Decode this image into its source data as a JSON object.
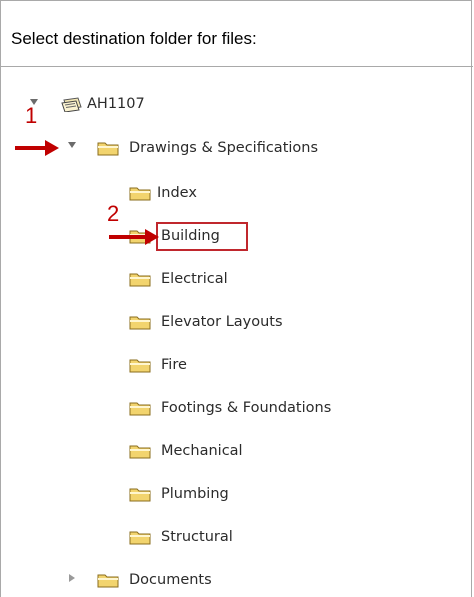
{
  "dialog": {
    "header": "Select destination folder for files:"
  },
  "tree": {
    "root": {
      "label": "AH1107",
      "expanded": true
    },
    "drawings": {
      "label": "Drawings & Specifications",
      "expanded": true
    },
    "children": [
      {
        "label": "Index"
      },
      {
        "label": "Building",
        "selected": true
      },
      {
        "label": "Electrical"
      },
      {
        "label": "Elevator Layouts"
      },
      {
        "label": "Fire"
      },
      {
        "label": "Footings & Foundations"
      },
      {
        "label": "Mechanical"
      },
      {
        "label": "Plumbing"
      },
      {
        "label": "Structural"
      }
    ],
    "documents": {
      "label": "Documents",
      "expanded": false
    }
  },
  "annotations": {
    "step1": "1",
    "step2": "2",
    "color": "#c00000"
  },
  "icons": {
    "folder": "folder-icon",
    "library": "library-icon",
    "expanded": "triangle-down-icon",
    "collapsed": "triangle-right-icon"
  }
}
